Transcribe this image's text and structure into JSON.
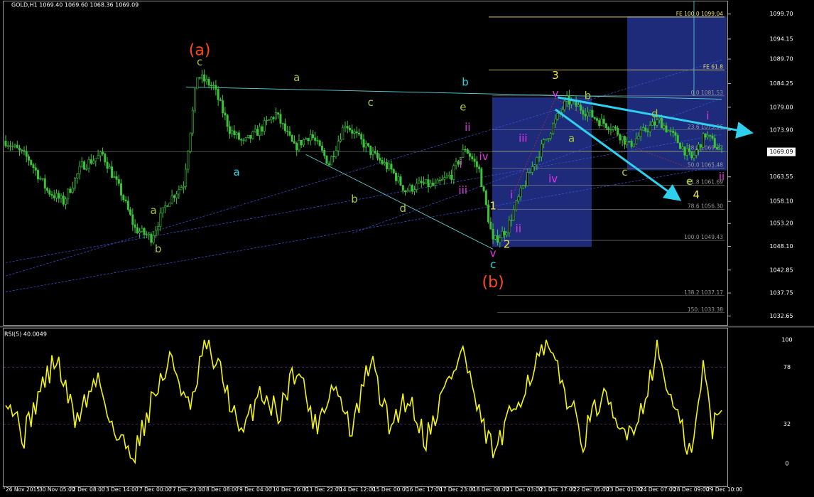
{
  "chart_data": [
    {
      "type": "candlestick",
      "title": "GOLD,H1  1069.40 1069.60 1068.36 1069.09",
      "symbol": "GOLD,H1",
      "last_ohlc": {
        "open": 1069.4,
        "high": 1069.6,
        "low": 1068.36,
        "close": 1069.09
      },
      "ylim": [
        1030.5,
        1102.5
      ],
      "y_ticks": [
        {
          "value": 1099.7,
          "label": "1099.70"
        },
        {
          "value": 1094.15,
          "label": "1094.15"
        },
        {
          "value": 1089.7,
          "label": "1089.70"
        },
        {
          "value": 1084.25,
          "label": "1084.25"
        },
        {
          "value": 1079.0,
          "label": "1079.00"
        },
        {
          "value": 1073.9,
          "label": "1073.90"
        },
        {
          "value": 1063.55,
          "label": "1063.55"
        },
        {
          "value": 1058.1,
          "label": "1058.10"
        },
        {
          "value": 1053.2,
          "label": "1053.20"
        },
        {
          "value": 1048.1,
          "label": "1048.10"
        },
        {
          "value": 1042.85,
          "label": "1042.85"
        },
        {
          "value": 1037.75,
          "label": "1037.75"
        },
        {
          "value": 1032.65,
          "label": "1032.65"
        }
      ],
      "current_price": {
        "value": 1069.09,
        "label": "1069.09"
      },
      "price_anchors": [
        {
          "bar": 0,
          "price": 1071.5
        },
        {
          "bar": 10,
          "price": 1067.5
        },
        {
          "bar": 18,
          "price": 1060.5
        },
        {
          "bar": 25,
          "price": 1058.0
        },
        {
          "bar": 33,
          "price": 1066.0
        },
        {
          "bar": 42,
          "price": 1068.5
        },
        {
          "bar": 50,
          "price": 1060.0
        },
        {
          "bar": 56,
          "price": 1052.0
        },
        {
          "bar": 63,
          "price": 1050.0
        },
        {
          "bar": 70,
          "price": 1058.0
        },
        {
          "bar": 77,
          "price": 1062.0
        },
        {
          "bar": 83,
          "price": 1086.0
        },
        {
          "bar": 90,
          "price": 1083.5
        },
        {
          "bar": 97,
          "price": 1074.0
        },
        {
          "bar": 103,
          "price": 1071.0
        },
        {
          "bar": 110,
          "price": 1074.0
        },
        {
          "bar": 117,
          "price": 1077.5
        },
        {
          "bar": 125,
          "price": 1070.0
        },
        {
          "bar": 132,
          "price": 1073.0
        },
        {
          "bar": 140,
          "price": 1066.5
        },
        {
          "bar": 147,
          "price": 1075.5
        },
        {
          "bar": 153,
          "price": 1072.0
        },
        {
          "bar": 160,
          "price": 1068.0
        },
        {
          "bar": 167,
          "price": 1065.0
        },
        {
          "bar": 173,
          "price": 1060.5
        },
        {
          "bar": 180,
          "price": 1062.0
        },
        {
          "bar": 186,
          "price": 1061.5
        },
        {
          "bar": 193,
          "price": 1064.0
        },
        {
          "bar": 199,
          "price": 1070.0
        },
        {
          "bar": 205,
          "price": 1065.0
        },
        {
          "bar": 211,
          "price": 1049.0
        },
        {
          "bar": 217,
          "price": 1052.0
        },
        {
          "bar": 223,
          "price": 1060.0
        },
        {
          "bar": 230,
          "price": 1068.0
        },
        {
          "bar": 237,
          "price": 1075.0
        },
        {
          "bar": 243,
          "price": 1080.5
        },
        {
          "bar": 250,
          "price": 1078.5
        },
        {
          "bar": 257,
          "price": 1076.0
        },
        {
          "bar": 263,
          "price": 1074.5
        },
        {
          "bar": 270,
          "price": 1070.5
        },
        {
          "bar": 277,
          "price": 1074.0
        },
        {
          "bar": 283,
          "price": 1076.0
        },
        {
          "bar": 290,
          "price": 1072.0
        },
        {
          "bar": 297,
          "price": 1067.5
        },
        {
          "bar": 303,
          "price": 1073.0
        },
        {
          "bar": 310,
          "price": 1069.0
        }
      ],
      "fibonacci_levels": [
        {
          "label": "0.0 1081.53",
          "price": 1081.53
        },
        {
          "label": "23.6 1073.96",
          "price": 1073.96
        },
        {
          "label": "38.2 1069.27",
          "price": 1069.27
        },
        {
          "label": "50.0 1065.48",
          "price": 1065.48
        },
        {
          "label": "61.8 1061.69",
          "price": 1061.69
        },
        {
          "label": "78.6 1056.30",
          "price": 1056.3
        },
        {
          "label": "100.0 1049.43",
          "price": 1049.43
        },
        {
          "label": "138.2 1037.17",
          "price": 1037.17
        },
        {
          "label": "150. 1033.38",
          "price": 1033.38
        }
      ],
      "fibonacci_expansion": [
        {
          "label": "FE 100.0 1099.04",
          "price": 1099.04
        },
        {
          "label": "FE 61.8",
          "price": 1087.3
        }
      ],
      "wave_labels": [
        {
          "text": "(a)",
          "bar": 84,
          "price": 1091.5,
          "color": "#ff4a1a"
        },
        {
          "text": "(b)",
          "bar": 211,
          "price": 1040.0,
          "color": "#ff4a1a"
        },
        {
          "text": "c",
          "bar": 84,
          "price": 1089.0,
          "color": "#a5c83c"
        },
        {
          "text": "a",
          "bar": 64,
          "price": 1056.0,
          "color": "#a5c83c"
        },
        {
          "text": "b",
          "bar": 66,
          "price": 1047.5,
          "color": "#a5c83c"
        },
        {
          "text": "a",
          "bar": 126,
          "price": 1085.5,
          "color": "#a5c83c"
        },
        {
          "text": "c",
          "bar": 158,
          "price": 1080.0,
          "color": "#a5c83c"
        },
        {
          "text": "b",
          "bar": 151,
          "price": 1058.5,
          "color": "#a5c83c"
        },
        {
          "text": "d",
          "bar": 172,
          "price": 1056.5,
          "color": "#a5c83c"
        },
        {
          "text": "e",
          "bar": 198,
          "price": 1079.0,
          "color": "#a5c83c"
        },
        {
          "text": "a",
          "bar": 100,
          "price": 1064.5,
          "color": "#2bd3e0"
        },
        {
          "text": "b",
          "bar": 199,
          "price": 1084.5,
          "color": "#2bd3e0"
        },
        {
          "text": "c",
          "bar": 211,
          "price": 1044.0,
          "color": "#2bd3e0"
        },
        {
          "text": "1",
          "bar": 211,
          "price": 1057.0,
          "color": "#f5e642"
        },
        {
          "text": "2",
          "bar": 217,
          "price": 1048.5,
          "color": "#f5e642"
        },
        {
          "text": "3",
          "bar": 238,
          "price": 1086.0,
          "color": "#f5e642"
        },
        {
          "text": "4",
          "bar": 299,
          "price": 1059.5,
          "color": "#f5e642"
        },
        {
          "text": "v",
          "bar": 238,
          "price": 1082.0,
          "color": "#e636e6"
        },
        {
          "text": "v",
          "bar": 211,
          "price": 1046.5,
          "color": "#e636e6"
        },
        {
          "text": "iii",
          "bar": 224,
          "price": 1072.0,
          "color": "#e636e6"
        },
        {
          "text": "iv",
          "bar": 207,
          "price": 1068.0,
          "color": "#e636e6"
        },
        {
          "text": "ii",
          "bar": 200,
          "price": 1074.5,
          "color": "#e636e6"
        },
        {
          "text": "i",
          "bar": 197,
          "price": 1066.5,
          "color": "#e636e6"
        },
        {
          "text": "iii",
          "bar": 198,
          "price": 1060.5,
          "color": "#e636e6"
        },
        {
          "text": "i",
          "bar": 219,
          "price": 1059.5,
          "color": "#e636e6"
        },
        {
          "text": "ii",
          "bar": 222,
          "price": 1052.0,
          "color": "#e636e6"
        },
        {
          "text": "iv",
          "bar": 237,
          "price": 1063.0,
          "color": "#e636e6"
        },
        {
          "text": "i",
          "bar": 304,
          "price": 1077.0,
          "color": "#e636e6"
        },
        {
          "text": "ii",
          "bar": 310,
          "price": 1063.5,
          "color": "#e636e6"
        },
        {
          "text": "b",
          "bar": 252,
          "price": 1081.5,
          "color": "#a5c83c"
        },
        {
          "text": "a",
          "bar": 245,
          "price": 1072.0,
          "color": "#a5c83c"
        },
        {
          "text": "c",
          "bar": 268,
          "price": 1064.5,
          "color": "#a5c83c"
        },
        {
          "text": "d",
          "bar": 281,
          "price": 1077.5,
          "color": "#a5c83c"
        },
        {
          "text": "e",
          "bar": 296,
          "price": 1062.5,
          "color": "#a5c83c"
        }
      ],
      "x_axis_labels": [
        "26 Nov 2015",
        "30 Nov 05:00",
        "2 Dec 08:00",
        "3 Dec 14:00",
        "7 Dec 00:00",
        "7 Dec 23:00",
        "8 Dec 08:00",
        "9 Dec 04:00",
        "10 Dec 16:00",
        "11 Dec 22:00",
        "14 Dec 12:00",
        "15 Dec 00:00",
        "16 Dec 17:00",
        "17 Dec 23:00",
        "18 Dec 08:00",
        "21 Dec 03:00",
        "21 Dec 17:00",
        "22 Dec 05:00",
        "23 Dec 01:00",
        "24 Dec 07:00",
        "28 Dec 09:00",
        "29 Dec 10:00"
      ],
      "colors": {
        "candles": "#3ac43a",
        "trendline": "#5fd8d8",
        "fib": "#8a8a8a",
        "fe": "#e9e46d",
        "zone": "#1e2a7a",
        "arrow": "#2fd0ee",
        "channel": "#3b56d8"
      }
    },
    {
      "type": "line",
      "title": "RSI(5) 40.0049",
      "ylim": [
        0,
        100
      ],
      "y_ticks": [
        {
          "value": 100,
          "label": "100"
        },
        {
          "value": 78,
          "label": "78"
        },
        {
          "value": 32,
          "label": "32"
        },
        {
          "value": 0,
          "label": "0"
        }
      ],
      "levels": [
        78,
        32
      ],
      "last_value": 40.0049,
      "line_color": "#f5f50a",
      "anchors": [
        {
          "bar": 0,
          "value": 58
        },
        {
          "bar": 8,
          "value": 22
        },
        {
          "bar": 15,
          "value": 60
        },
        {
          "bar": 22,
          "value": 85
        },
        {
          "bar": 30,
          "value": 35
        },
        {
          "bar": 40,
          "value": 70
        },
        {
          "bar": 48,
          "value": 20
        },
        {
          "bar": 56,
          "value": 10
        },
        {
          "bar": 64,
          "value": 55
        },
        {
          "bar": 72,
          "value": 85
        },
        {
          "bar": 80,
          "value": 40
        },
        {
          "bar": 86,
          "value": 96
        },
        {
          "bar": 94,
          "value": 70
        },
        {
          "bar": 102,
          "value": 20
        },
        {
          "bar": 110,
          "value": 60
        },
        {
          "bar": 118,
          "value": 40
        },
        {
          "bar": 126,
          "value": 80
        },
        {
          "bar": 134,
          "value": 30
        },
        {
          "bar": 142,
          "value": 65
        },
        {
          "bar": 150,
          "value": 25
        },
        {
          "bar": 158,
          "value": 85
        },
        {
          "bar": 166,
          "value": 30
        },
        {
          "bar": 174,
          "value": 55
        },
        {
          "bar": 182,
          "value": 20
        },
        {
          "bar": 190,
          "value": 60
        },
        {
          "bar": 198,
          "value": 92
        },
        {
          "bar": 206,
          "value": 30
        },
        {
          "bar": 212,
          "value": 8
        },
        {
          "bar": 220,
          "value": 45
        },
        {
          "bar": 228,
          "value": 75
        },
        {
          "bar": 234,
          "value": 95
        },
        {
          "bar": 242,
          "value": 60
        },
        {
          "bar": 250,
          "value": 20
        },
        {
          "bar": 258,
          "value": 55
        },
        {
          "bar": 266,
          "value": 25
        },
        {
          "bar": 274,
          "value": 35
        },
        {
          "bar": 282,
          "value": 92
        },
        {
          "bar": 290,
          "value": 40
        },
        {
          "bar": 297,
          "value": 5
        },
        {
          "bar": 302,
          "value": 78
        },
        {
          "bar": 306,
          "value": 30
        },
        {
          "bar": 310,
          "value": 40
        }
      ]
    }
  ]
}
